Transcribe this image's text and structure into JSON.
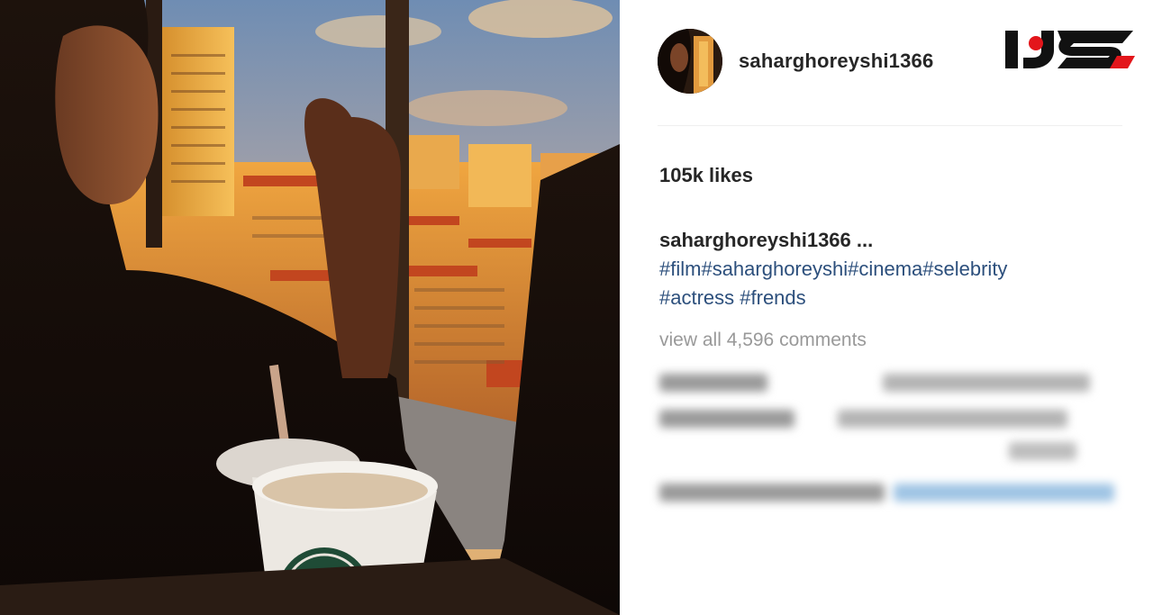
{
  "post": {
    "username": "saharghoreyshi1366",
    "likes": "105k likes",
    "caption": {
      "username": "saharghoreyshi1366",
      "ellipsis": " ...",
      "tags_line1": [
        "#film",
        "#saharghoreyshi",
        "#cinema",
        "#selebrity"
      ],
      "tags_line2": [
        "#actress",
        " #frends"
      ]
    },
    "view_all_comments": "view all 4,596 comments"
  },
  "icons": {
    "brand_logo": "rokna-logo",
    "avatar": "profile-avatar"
  },
  "colors": {
    "link_blue": "#2c4f7c",
    "muted_gray": "#999999",
    "brand_red": "#e3161b",
    "brand_black": "#111111"
  }
}
